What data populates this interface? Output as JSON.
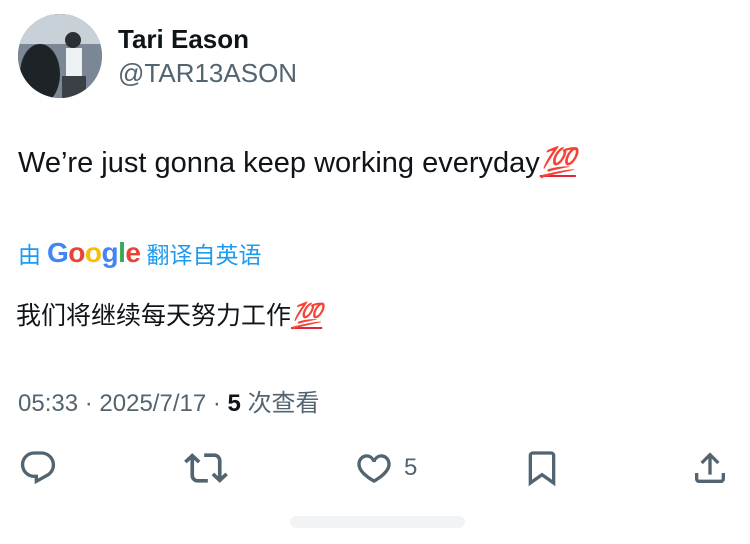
{
  "author": {
    "name": "Tari Eason",
    "handle": "@TAR13ASON"
  },
  "tweet": {
    "text": "We’re just gonna keep working everyday",
    "emoji": "💯"
  },
  "translation": {
    "prefix": "由",
    "provider": "Google",
    "suffix": "翻译自英语",
    "text": "我们将继续每天努力工作",
    "emoji": "💯"
  },
  "meta": {
    "time": "05:33",
    "separator": "·",
    "date": "2025/7/17",
    "views_count": "5",
    "views_label": "次查看"
  },
  "actions": {
    "reply_icon": "reply-icon",
    "retweet_icon": "retweet-icon",
    "like_icon": "heart-icon",
    "like_count": "5",
    "bookmark_icon": "bookmark-icon",
    "share_icon": "share-icon"
  },
  "colors": {
    "link_blue": "#1d9bf0",
    "secondary_text": "#536471",
    "primary_text": "#0f1419"
  }
}
